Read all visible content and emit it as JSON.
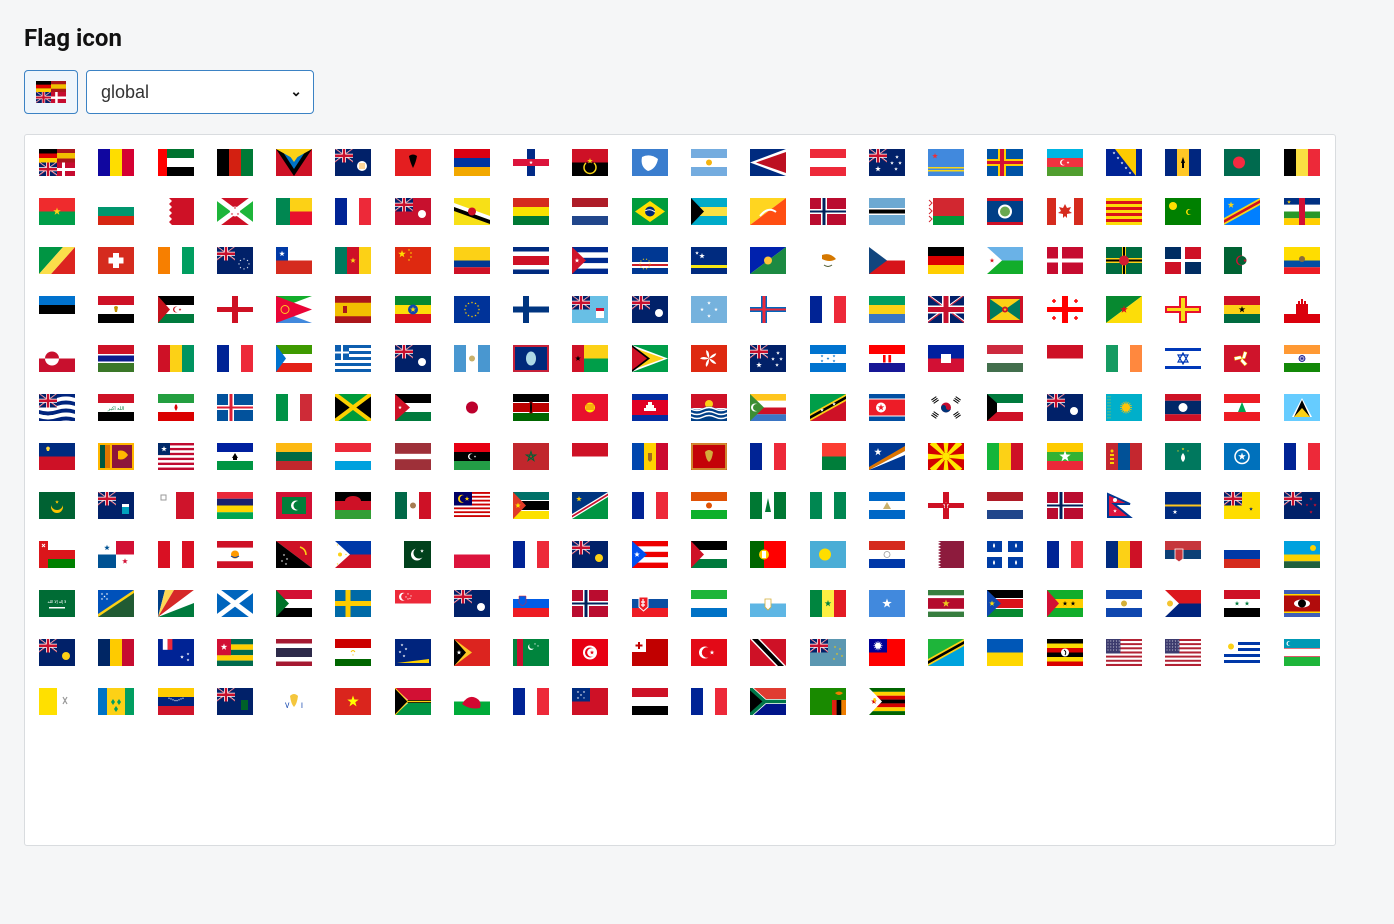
{
  "heading": "Flag icon",
  "dropdown": {
    "selected": "global",
    "options": [
      "global"
    ]
  },
  "current_flag": "global",
  "grid_columns": 22,
  "flags": [
    "global",
    "ad",
    "ae",
    "af",
    "ag",
    "ai",
    "al",
    "am",
    "an",
    "ao",
    "aq",
    "ar",
    "as",
    "at",
    "au",
    "aw",
    "ax",
    "az",
    "ba",
    "bb",
    "bd",
    "be",
    "bf",
    "bg",
    "bh",
    "bi",
    "bj",
    "bl",
    "bm",
    "bn",
    "bo",
    "bq",
    "br",
    "bs",
    "bt",
    "bv",
    "bw",
    "by",
    "bz",
    "ca",
    "catalonia",
    "cc",
    "cd",
    "cf",
    "cg",
    "ch",
    "ci",
    "ck",
    "cl",
    "cm",
    "cn",
    "co",
    "cr",
    "cu",
    "cv",
    "cw",
    "cx",
    "cy",
    "cz",
    "de",
    "dj",
    "dk",
    "dm",
    "do",
    "dz",
    "ec",
    "ee",
    "eg",
    "eh",
    "england",
    "er",
    "es",
    "et",
    "eu",
    "fi",
    "fj",
    "fk",
    "fm",
    "fo",
    "fr",
    "ga",
    "gb",
    "gd",
    "ge",
    "gf",
    "gg",
    "gh",
    "gi",
    "gl",
    "gm",
    "gn",
    "gp",
    "gq",
    "gr",
    "gs",
    "gt",
    "gu",
    "gw",
    "gy",
    "hk",
    "hm",
    "hn",
    "hr",
    "ht",
    "hu",
    "id",
    "ie",
    "il",
    "im",
    "in",
    "io",
    "iq",
    "ir",
    "is",
    "it",
    "jm",
    "jo",
    "jp",
    "ke",
    "kg",
    "kh",
    "ki",
    "km",
    "kn",
    "kp",
    "kr",
    "kw",
    "ky",
    "kz",
    "la",
    "lb",
    "lc",
    "li",
    "lk",
    "lr",
    "ls",
    "lt",
    "lu",
    "lv",
    "ly",
    "ma",
    "mc",
    "md",
    "me",
    "mf",
    "mg",
    "mh",
    "mk",
    "ml",
    "mm",
    "mn",
    "mo",
    "mp",
    "mq",
    "mr",
    "ms",
    "mt",
    "mu",
    "mv",
    "mw",
    "mx",
    "my",
    "mz",
    "na",
    "nc",
    "ne",
    "nf",
    "ng",
    "ni",
    "northern-ireland",
    "nl",
    "no",
    "np",
    "nr",
    "nu",
    "nz",
    "om",
    "pa",
    "pe",
    "pf",
    "pg",
    "ph",
    "pk",
    "pl",
    "pm",
    "pn",
    "pr",
    "ps",
    "pt",
    "pw",
    "py",
    "qa",
    "quebec",
    "re",
    "ro",
    "rs",
    "ru",
    "rw",
    "sa",
    "sb",
    "sc",
    "scotland",
    "sd",
    "se",
    "sg",
    "sh",
    "si",
    "sj",
    "sk",
    "sl",
    "sm",
    "sn",
    "so",
    "sr",
    "ss",
    "st",
    "sv",
    "sx",
    "sy",
    "sz",
    "tc",
    "td",
    "tf",
    "tg",
    "th",
    "tj",
    "tk",
    "tl",
    "tm",
    "tn",
    "to",
    "tr",
    "tt",
    "tv",
    "tw",
    "tz",
    "ua",
    "ug",
    "um",
    "us",
    "uy",
    "uz",
    "va",
    "vc",
    "ve",
    "vg",
    "vi",
    "vn",
    "vu",
    "wales",
    "wf",
    "ws",
    "ye",
    "yt",
    "za",
    "zm",
    "zw"
  ]
}
